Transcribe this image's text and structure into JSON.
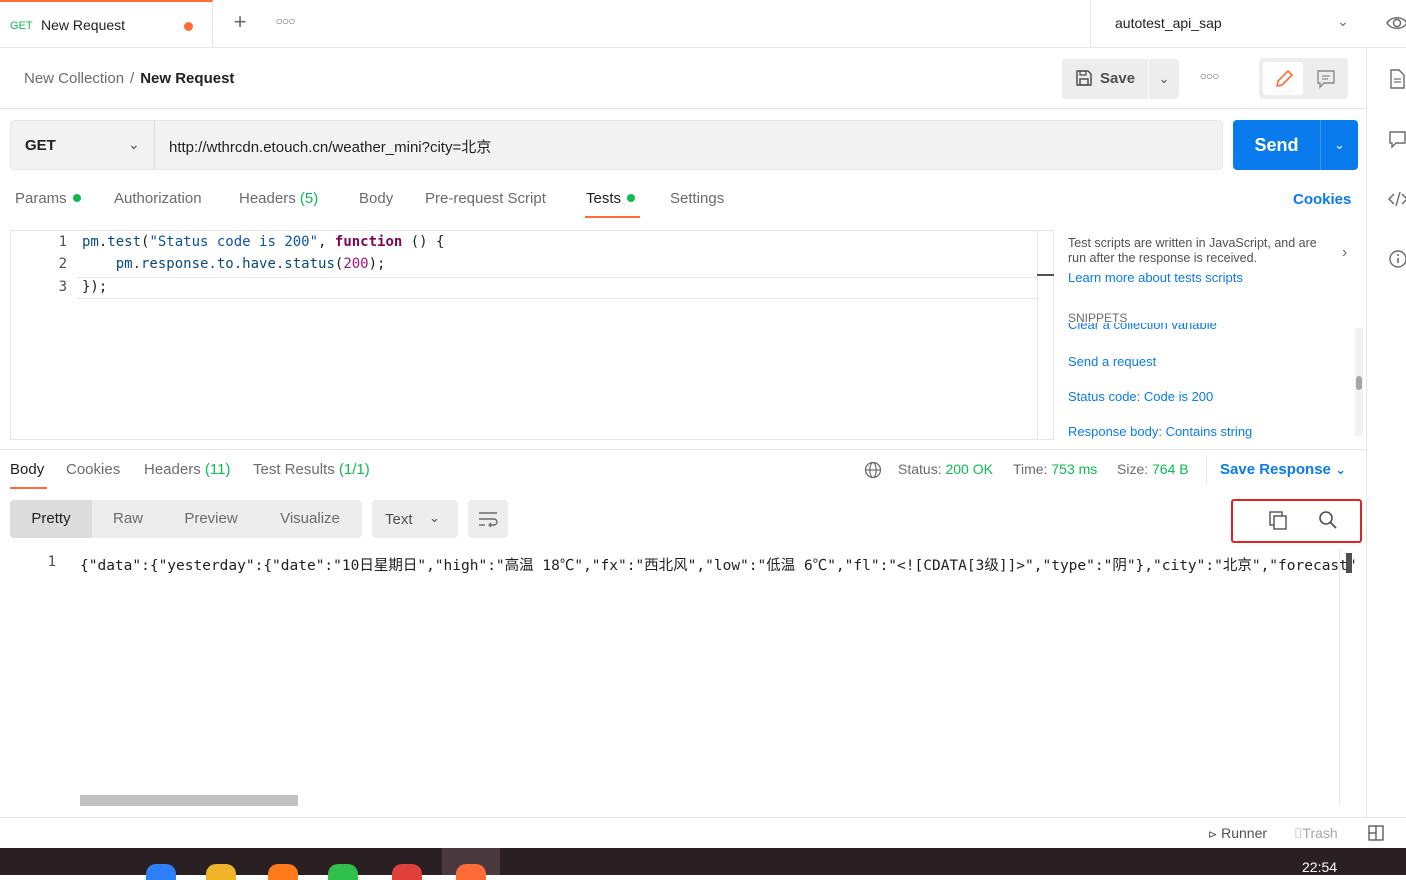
{
  "tab": {
    "method": "GET",
    "name": "New Request"
  },
  "environment": {
    "selected": "autotest_api_sap"
  },
  "breadcrumb": {
    "collection": "New Collection",
    "separator": "/",
    "request": "New Request"
  },
  "toolbar": {
    "save_label": "Save"
  },
  "request": {
    "method": "GET",
    "url": "http://wthrcdn.etouch.cn/weather_mini?city=北京",
    "send_label": "Send"
  },
  "request_tabs": {
    "params": "Params",
    "authorization": "Authorization",
    "headers": "Headers",
    "headers_count": "(5)",
    "body": "Body",
    "pre_request": "Pre-request Script",
    "tests": "Tests",
    "settings": "Settings",
    "cookies": "Cookies"
  },
  "editor": {
    "line_numbers": [
      "1",
      "2",
      "3"
    ],
    "lines": {
      "l1_obj": "pm",
      "l1_dot": ".",
      "l1_fn": "test",
      "l1_open": "(",
      "l1_str": "\"Status code is 200\"",
      "l1_comma": ", ",
      "l1_kw": "function",
      "l1_rest": " () {",
      "l2_indent": "    ",
      "l2_obj": "pm",
      "l2_chain": ".response.to.have.status",
      "l2_open": "(",
      "l2_num": "200",
      "l2_close": ");",
      "l3": "});"
    }
  },
  "snippets": {
    "description": "Test scripts are written in JavaScript, and are run after the response is received.",
    "learn_more": "Learn more about tests scripts",
    "title": "SNIPPETS",
    "items": [
      "Clear a collection variable",
      "Send a request",
      "Status code: Code is 200",
      "Response body: Contains string"
    ]
  },
  "response_tabs": {
    "body": "Body",
    "cookies": "Cookies",
    "headers": "Headers",
    "headers_count": "(11)",
    "test_results": "Test Results",
    "test_results_count": "(1/1)"
  },
  "response_meta": {
    "status_label": "Status:",
    "status_value": "200 OK",
    "time_label": "Time:",
    "time_value": "753 ms",
    "size_label": "Size:",
    "size_value": "764 B",
    "save_response": "Save Response"
  },
  "view_modes": {
    "pretty": "Pretty",
    "raw": "Raw",
    "preview": "Preview",
    "visualize": "Visualize",
    "format": "Text"
  },
  "response_body": {
    "line_number": "1",
    "text": "{\"data\":{\"yesterday\":{\"date\":\"10日星期日\",\"high\":\"高温 18℃\",\"fx\":\"西北风\",\"low\":\"低温 6℃\",\"fl\":\"<![CDATA[3级]]>\",\"type\":\"阴\"},\"city\":\"北京\",\"forecast\""
  },
  "statusbar": {
    "runner": "Runner",
    "trash": "Trash"
  },
  "taskbar": {
    "time": "22:54"
  },
  "colors": {
    "accent": "#ff6c37",
    "primary": "#097bed",
    "success": "#0cbb52",
    "highlight_box": "#e02424"
  },
  "icons": {
    "eye": "eye-icon",
    "save": "save-icon",
    "pencil": "pencil-icon",
    "comment": "comment-icon",
    "globe": "globe-icon",
    "copy": "copy-icon",
    "search": "search-icon",
    "wrap": "wrap-lines-icon",
    "document": "document-icon",
    "code": "code-icon",
    "info": "info-icon"
  }
}
